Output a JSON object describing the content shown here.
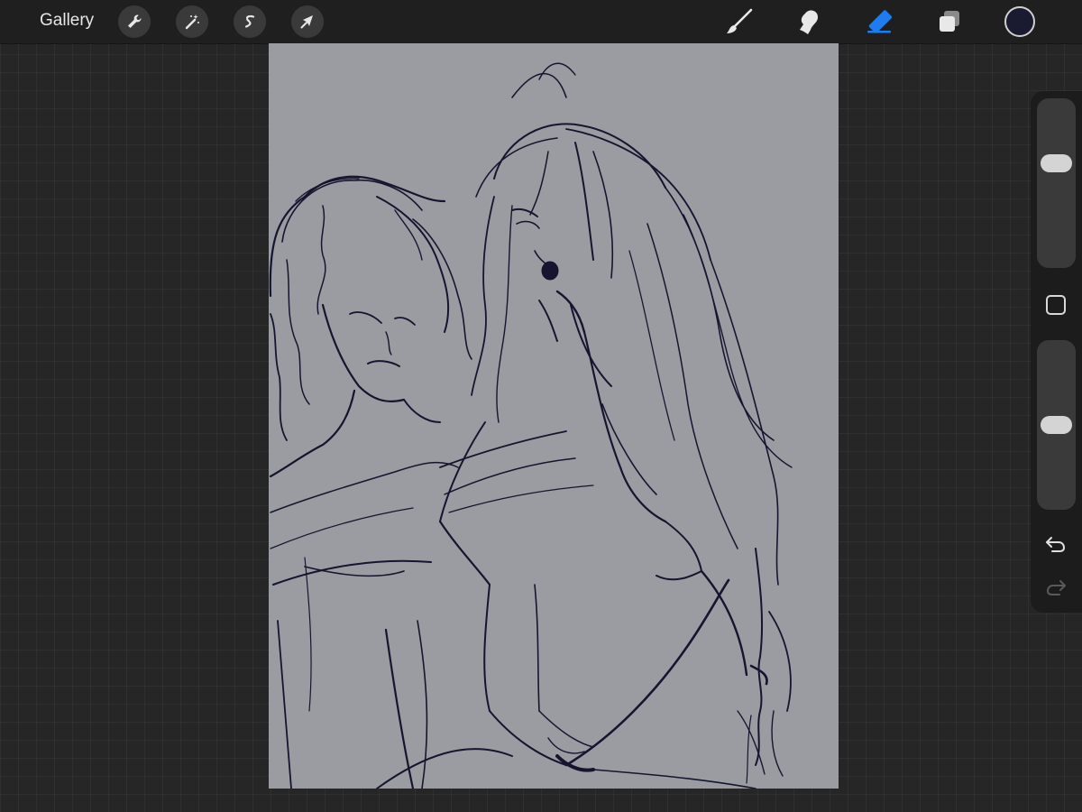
{
  "toolbar": {
    "gallery_label": "Gallery",
    "left_tools": [
      {
        "icon": "wrench-icon",
        "name": "actions"
      },
      {
        "icon": "magic-wand-icon",
        "name": "adjustments"
      },
      {
        "icon": "selection-s-icon",
        "name": "selection"
      },
      {
        "icon": "arrow-cursor-icon",
        "name": "transform"
      }
    ],
    "right_tools": [
      {
        "icon": "brush-icon",
        "name": "paint",
        "active": false
      },
      {
        "icon": "smudge-icon",
        "name": "smudge",
        "active": false
      },
      {
        "icon": "eraser-icon",
        "name": "eraser",
        "active": true
      },
      {
        "icon": "layers-icon",
        "name": "layers",
        "active": false
      }
    ],
    "current_color": "#1a1a30",
    "active_tool_color": "#1e7cf2"
  },
  "canvas": {
    "background_color": "#9a9ca1",
    "stroke_color": "#151530"
  },
  "sidebar": {
    "brush_size_level": 0.38,
    "opacity_level": 0.5,
    "modify_button_icon": "square-icon",
    "undo_icon": "undo-icon",
    "redo_icon": "redo-icon"
  }
}
